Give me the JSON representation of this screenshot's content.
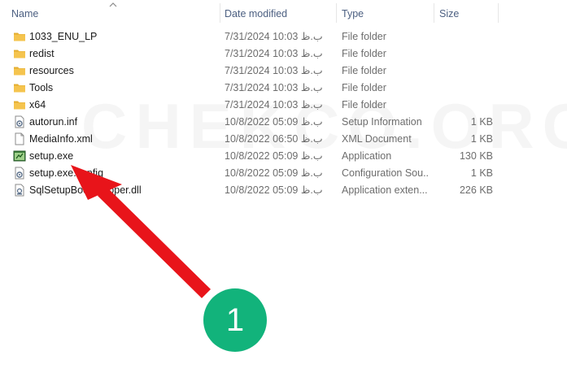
{
  "columns": {
    "name": "Name",
    "date_modified": "Date modified",
    "type": "Type",
    "size": "Size"
  },
  "sort_indicator": "chevron-up-icon",
  "files": [
    {
      "name": "1033_ENU_LP",
      "date": "7/31/2024 10:03 ب.ظ",
      "type": "File folder",
      "size": "",
      "icon": "folder-icon"
    },
    {
      "name": "redist",
      "date": "7/31/2024 10:03 ب.ظ",
      "type": "File folder",
      "size": "",
      "icon": "folder-icon"
    },
    {
      "name": "resources",
      "date": "7/31/2024 10:03 ب.ظ",
      "type": "File folder",
      "size": "",
      "icon": "folder-icon"
    },
    {
      "name": "Tools",
      "date": "7/31/2024 10:03 ب.ظ",
      "type": "File folder",
      "size": "",
      "icon": "folder-icon"
    },
    {
      "name": "x64",
      "date": "7/31/2024 10:03 ب.ظ",
      "type": "File folder",
      "size": "",
      "icon": "folder-icon"
    },
    {
      "name": "autorun.inf",
      "date": "10/8/2022 05:09 ب.ظ",
      "type": "Setup Information",
      "size": "1 KB",
      "icon": "settings-file-icon"
    },
    {
      "name": "MediaInfo.xml",
      "date": "10/8/2022 06:50 ب.ظ",
      "type": "XML Document",
      "size": "1 KB",
      "icon": "document-icon"
    },
    {
      "name": "setup.exe",
      "date": "10/8/2022 05:09 ب.ظ",
      "type": "Application",
      "size": "130 KB",
      "icon": "application-icon"
    },
    {
      "name": "setup.exe.config",
      "date": "10/8/2022 05:09 ب.ظ",
      "type": "Configuration Sou...",
      "size": "1 KB",
      "icon": "settings-file-icon"
    },
    {
      "name": "SqlSetupBootstrapper.dll",
      "date": "10/8/2022 05:09 ب.ظ",
      "type": "Application exten...",
      "size": "226 KB",
      "icon": "dll-file-icon"
    }
  ],
  "watermark": "CHEKCO.ORG",
  "annotation": {
    "step_number": "1",
    "arrow_color": "#e8141a",
    "badge_color": "#12b37b"
  },
  "colors": {
    "folder": "#f5c44e",
    "header_text": "#4d6082",
    "secondary_text": "#6d6d6d"
  }
}
